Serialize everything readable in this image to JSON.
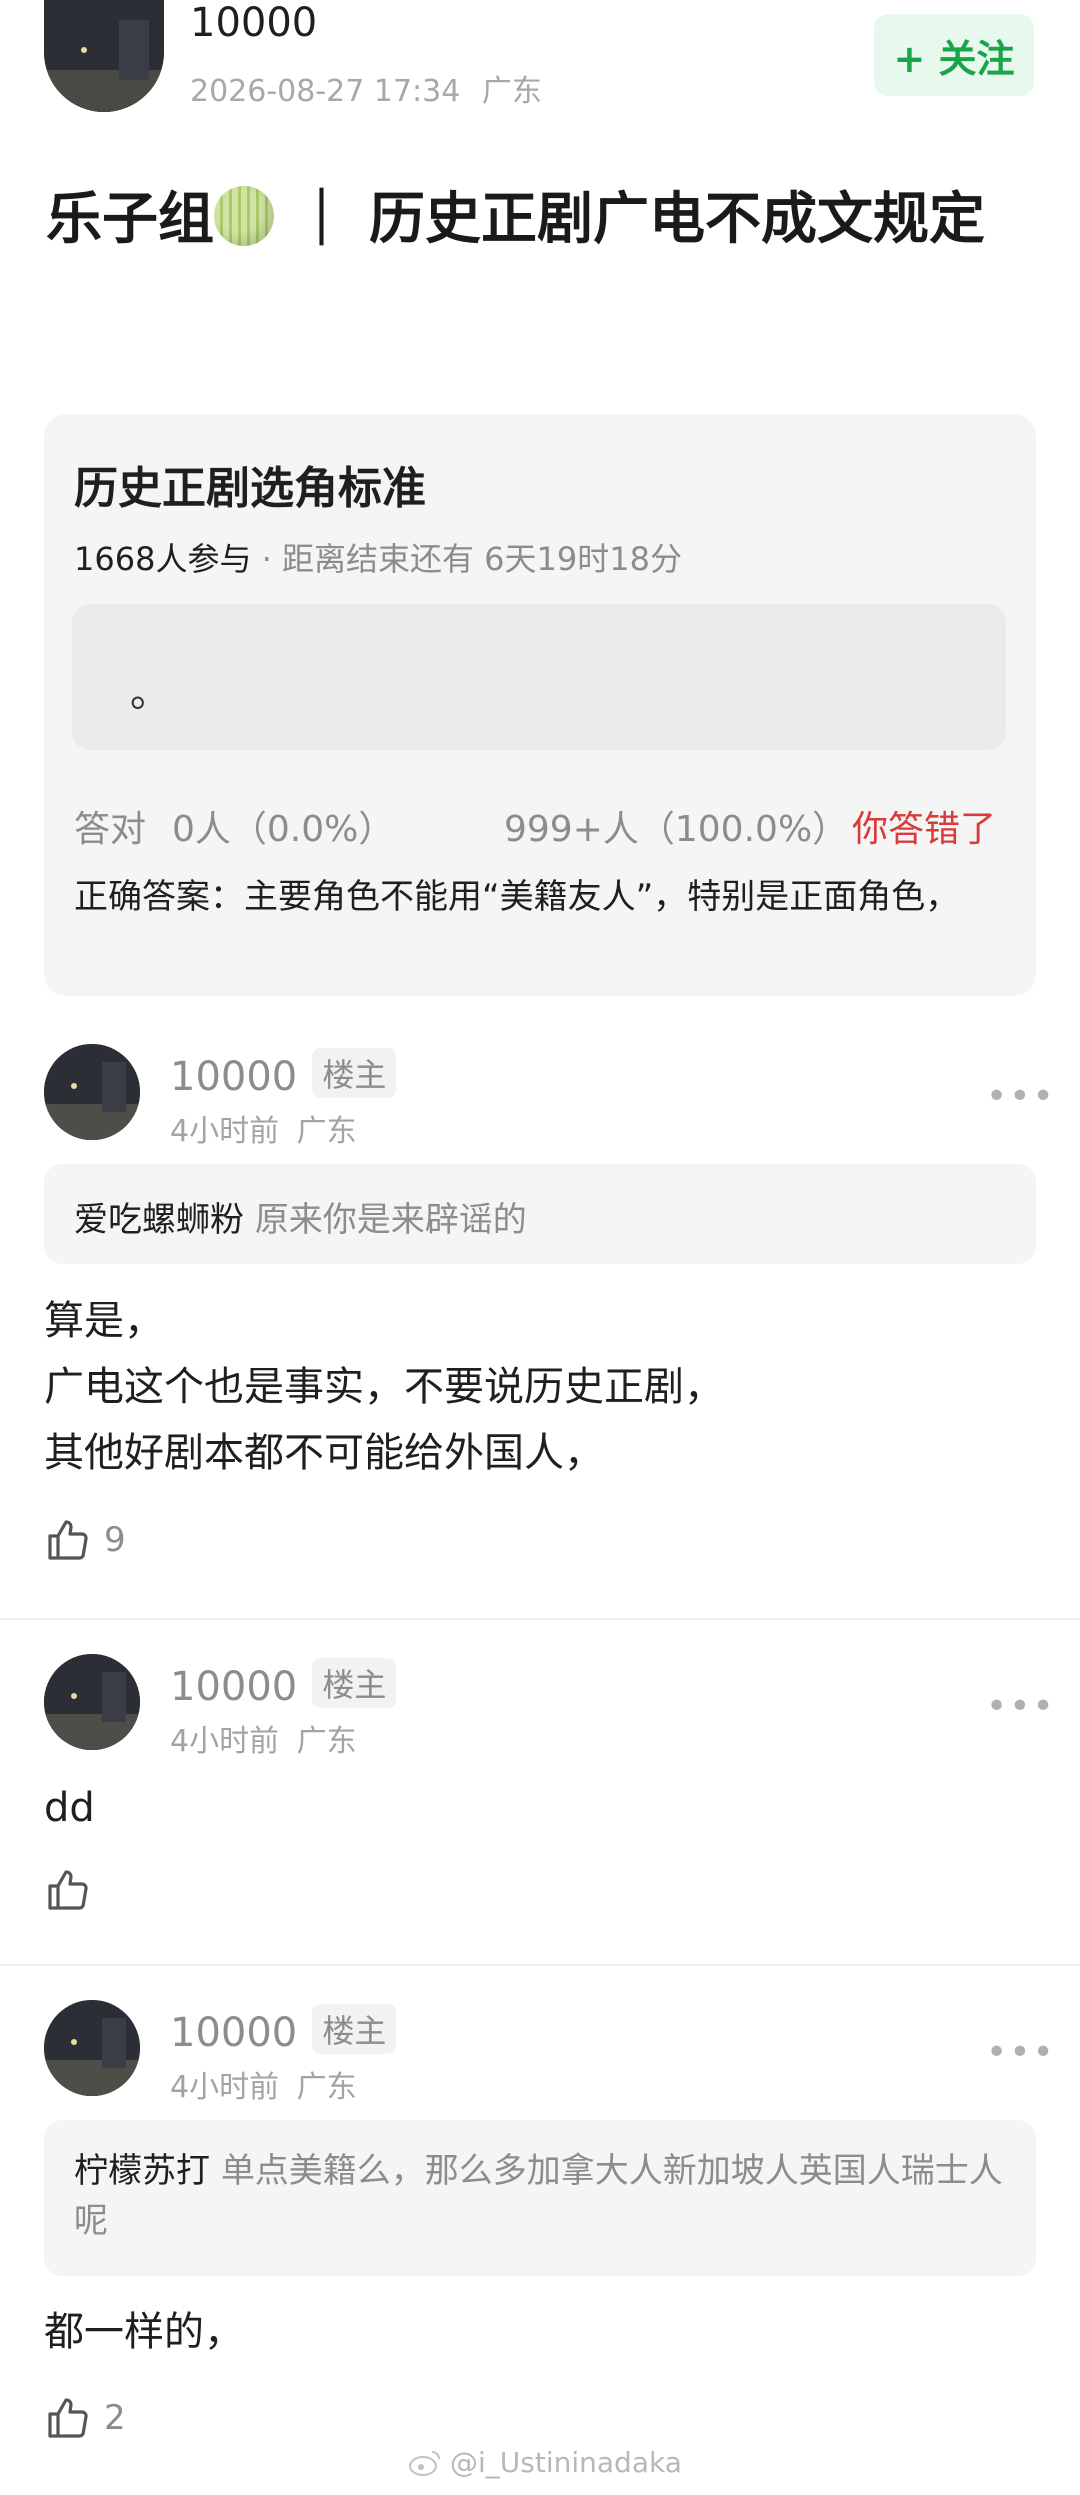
{
  "post": {
    "author": "10000",
    "meta_time": "2026-08-27 17:34",
    "meta_location": "广东",
    "follow_label": "+ 关注",
    "title_prefix": "乐子组",
    "title_suffix": " ｜ 历史正剧广电不成文规定"
  },
  "quiz": {
    "title": "历史正剧选角标准",
    "participants": "1668人参与",
    "countdown": "· 距离结束还有 6天19时18分",
    "option_text": "。",
    "correct_label": "答对",
    "correct_stat": "0人（0.0%）",
    "wrong_stat": "999+人（100.0%）",
    "wrong_verdict": "你答错了",
    "answer": "正确答案：主要角色不能用“美籍友人”，特别是正面角色，"
  },
  "comments": [
    {
      "author": "10000",
      "tag": "楼主",
      "time": "4小时前",
      "location": "广东",
      "quote_user": "爱吃螺蛳粉",
      "quote_text": "原来你是来辟谣的",
      "body": "算是，\n广电这个也是事实，不要说历史正剧，\n其他好剧本都不可能给外国人，",
      "likes": "9"
    },
    {
      "author": "10000",
      "tag": "楼主",
      "time": "4小时前",
      "location": "广东",
      "body": "dd",
      "likes": ""
    },
    {
      "author": "10000",
      "tag": "楼主",
      "time": "4小时前",
      "location": "广东",
      "quote_user": "柠檬苏打",
      "quote_text": "单点美籍么，那么多加拿大人新加坡人英国人瑞士人呢",
      "body": "都一样的，",
      "likes": "2"
    }
  ],
  "watermark": "@i_Ustininadaka",
  "colors": {
    "accent_green": "#19a34b",
    "follow_bg": "#e7f8ec",
    "wrong_red": "#d93a3a"
  }
}
